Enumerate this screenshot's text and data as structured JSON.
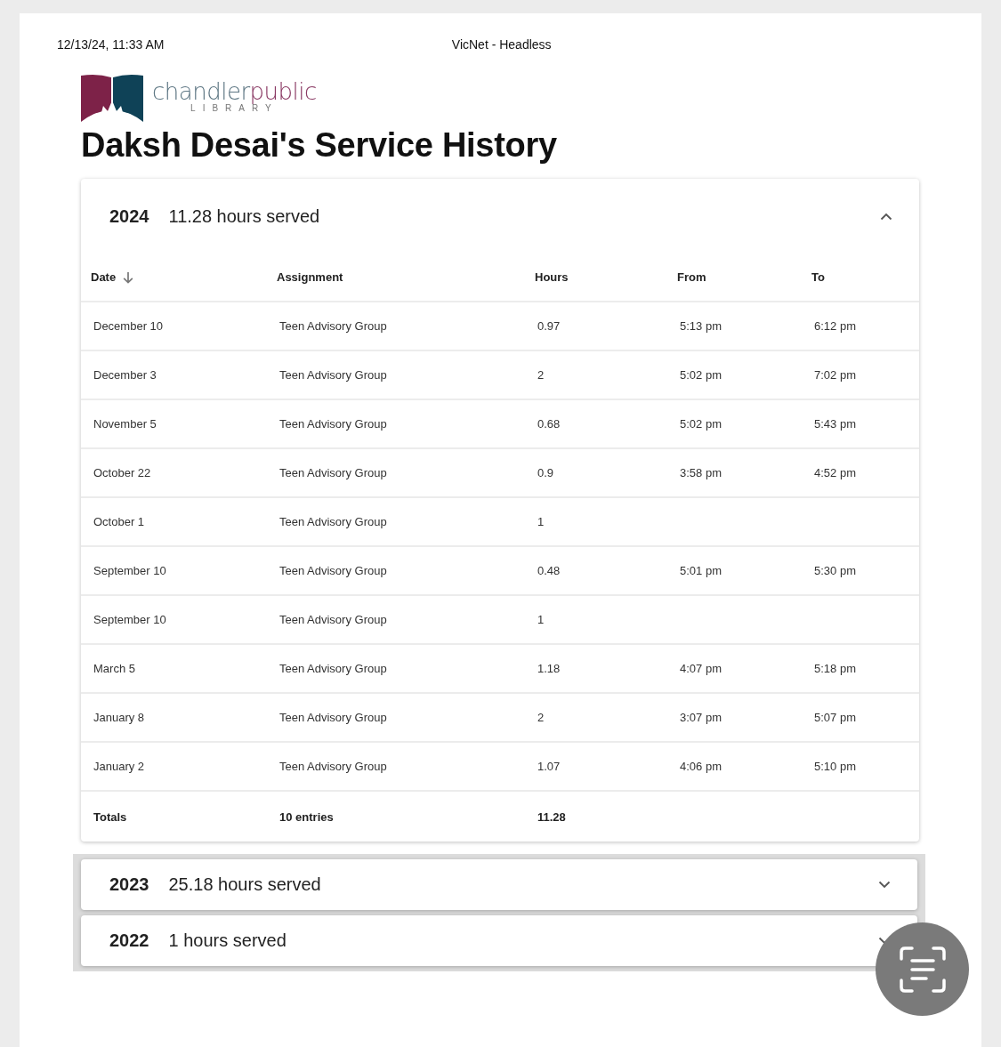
{
  "print_header": {
    "date": "12/13/24, 11:33 AM",
    "title": "VicNet - Headless"
  },
  "logo": {
    "name_part_1": "chandler",
    "name_part_2": "public",
    "subtitle": "LIBRARY"
  },
  "page_title": "Daksh Desai's Service History",
  "years": [
    {
      "year": "2024",
      "summary": "11.28 hours served",
      "expanded": true,
      "table": {
        "columns": [
          {
            "label": "Date",
            "sorted": true
          },
          {
            "label": "Assignment",
            "sorted": false
          },
          {
            "label": "Hours",
            "sorted": false
          },
          {
            "label": "From",
            "sorted": false
          },
          {
            "label": "To",
            "sorted": false
          }
        ],
        "rows": [
          {
            "date": "December 10",
            "assignment": "Teen Advisory Group",
            "hours": "0.97",
            "from": "5:13 pm",
            "to": "6:12 pm"
          },
          {
            "date": "December 3",
            "assignment": "Teen Advisory Group",
            "hours": "2",
            "from": "5:02 pm",
            "to": "7:02 pm"
          },
          {
            "date": "November 5",
            "assignment": "Teen Advisory Group",
            "hours": "0.68",
            "from": "5:02 pm",
            "to": "5:43 pm"
          },
          {
            "date": "October 22",
            "assignment": "Teen Advisory Group",
            "hours": "0.9",
            "from": "3:58 pm",
            "to": "4:52 pm"
          },
          {
            "date": "October 1",
            "assignment": "Teen Advisory Group",
            "hours": "1"
          },
          {
            "date": "September 10",
            "assignment": "Teen Advisory Group",
            "hours": "0.48",
            "from": "5:01 pm",
            "to": "5:30 pm"
          },
          {
            "date": "September 10",
            "assignment": "Teen Advisory Group",
            "hours": "1"
          },
          {
            "date": "March 5",
            "assignment": "Teen Advisory Group",
            "hours": "1.18",
            "from": "4:07 pm",
            "to": "5:18 pm"
          },
          {
            "date": "January 8",
            "assignment": "Teen Advisory Group",
            "hours": "2",
            "from": "3:07 pm",
            "to": "5:07 pm"
          },
          {
            "date": "January 2",
            "assignment": "Teen Advisory Group",
            "hours": "1.07",
            "from": "4:06 pm",
            "to": "5:10 pm"
          }
        ],
        "totals": {
          "label": "Totals",
          "entries": "10 entries",
          "hours": "11.28"
        }
      }
    },
    {
      "year": "2023",
      "summary": "25.18 hours served",
      "expanded": false
    },
    {
      "year": "2022",
      "summary": "1 hours served",
      "expanded": false
    }
  ]
}
